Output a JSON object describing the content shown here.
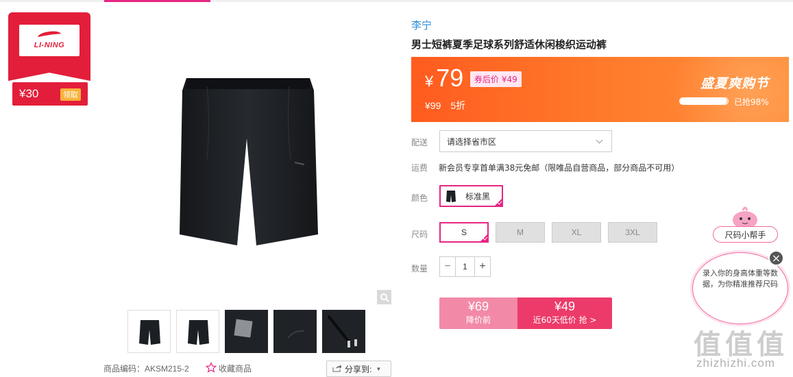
{
  "coupon": {
    "brand_logo_text": "LI-NING",
    "amount": "¥30",
    "claim_label": "领取"
  },
  "product": {
    "brand": "李宁",
    "title": "男士短裤夏季足球系列舒适休闲梭织运动裤",
    "sku_label": "商品编码：AKSM215-2",
    "favorite_label": "收藏商品",
    "share_label": "分享到:"
  },
  "price": {
    "currency": "¥",
    "now": "79",
    "coupon_price": "券后价 ¥49",
    "original": "¥99",
    "discount": "5折",
    "event_title": "盛夏爽购节",
    "sold_fraction": 0.98,
    "sold_label": "已抢98%"
  },
  "options": {
    "delivery_label": "配送",
    "delivery_value": "请选择省市区",
    "shipping_label": "运费",
    "shipping_text": "新会员专享首单满38元免邮（限唯品自营商品，部分商品不可用）",
    "color_label": "颜色",
    "color_value": "标准黑",
    "size_label": "尺码",
    "sizes": [
      "S",
      "M",
      "XL",
      "3XL"
    ],
    "qty_label": "数量",
    "qty_value": "1"
  },
  "buy": {
    "left_price": "¥69",
    "left_label": "降价前",
    "right_price": "¥49",
    "right_label": "近60天低价 抢 >"
  },
  "helper": {
    "tag": "尺码小帮手",
    "bubble_text": "录入你的身高体重等数据，为你精准推荐尺码",
    "close": "×"
  },
  "watermark": {
    "big": "值值值",
    "small": "zhizhizhi.com"
  },
  "colors": {
    "accent": "#e62584",
    "brand_red": "#e31e3a",
    "price_bar": "#ff6a28",
    "link": "#2a8ad6"
  }
}
